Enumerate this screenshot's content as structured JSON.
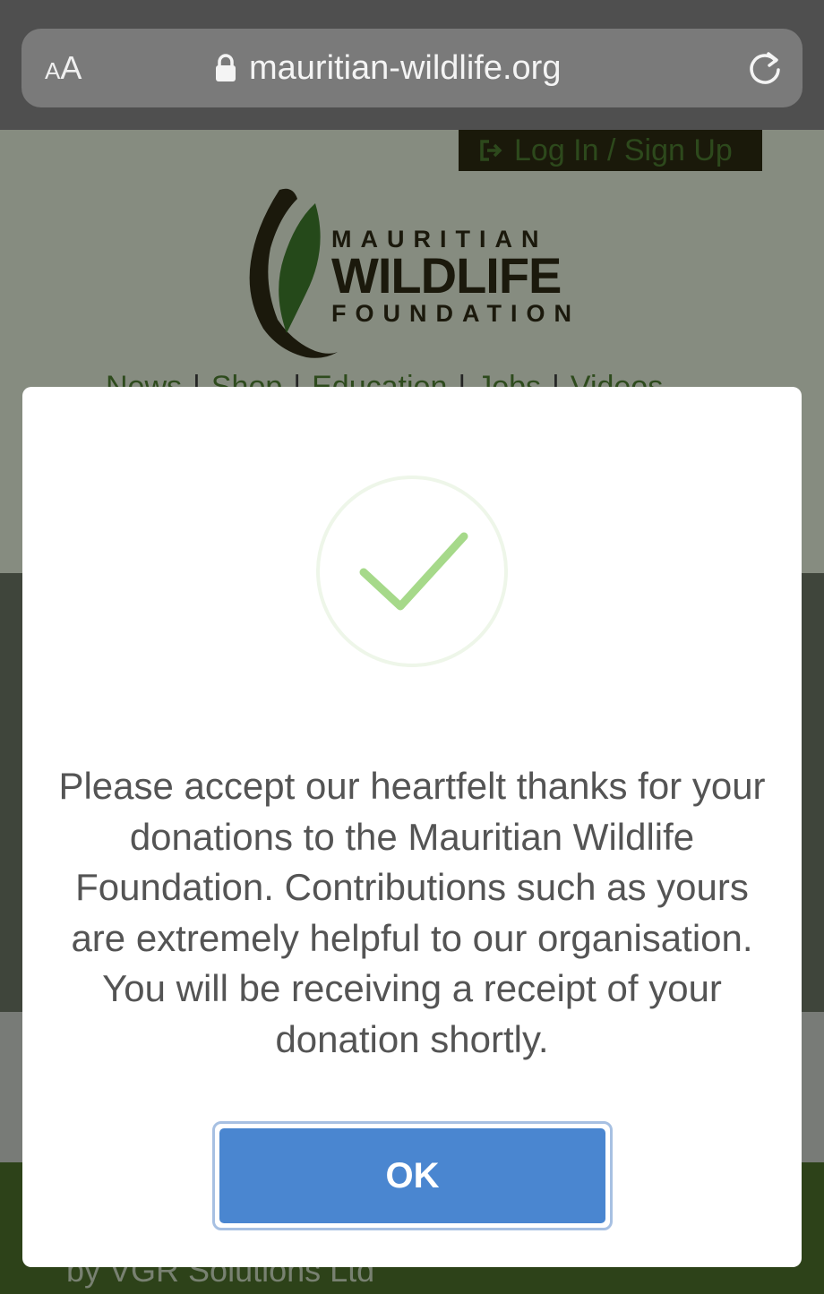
{
  "browser": {
    "text_size_label_small": "A",
    "text_size_label_large": "A",
    "url": "mauritian-wildlife.org"
  },
  "site": {
    "login_label": "Log In / Sign Up",
    "logo": {
      "line1": "MAURITIAN",
      "line2": "WILDLIFE",
      "line3": "FOUNDATION"
    },
    "nav": [
      "News",
      "Shop",
      "Education",
      "Jobs",
      "Videos"
    ],
    "footer_credit": "by VGR Solutions Ltd"
  },
  "modal": {
    "message": "Please accept our heartfelt thanks for your donations to the Mauritian Wildlife Foundation. Contributions such as yours are extremely helpful to our organisation. You will be receiving a receipt of your donation shortly.",
    "ok_label": "OK"
  },
  "colors": {
    "confirm_button": "#4a86d0",
    "success_check": "#a6d98a",
    "brand_green": "#4e7d31"
  }
}
